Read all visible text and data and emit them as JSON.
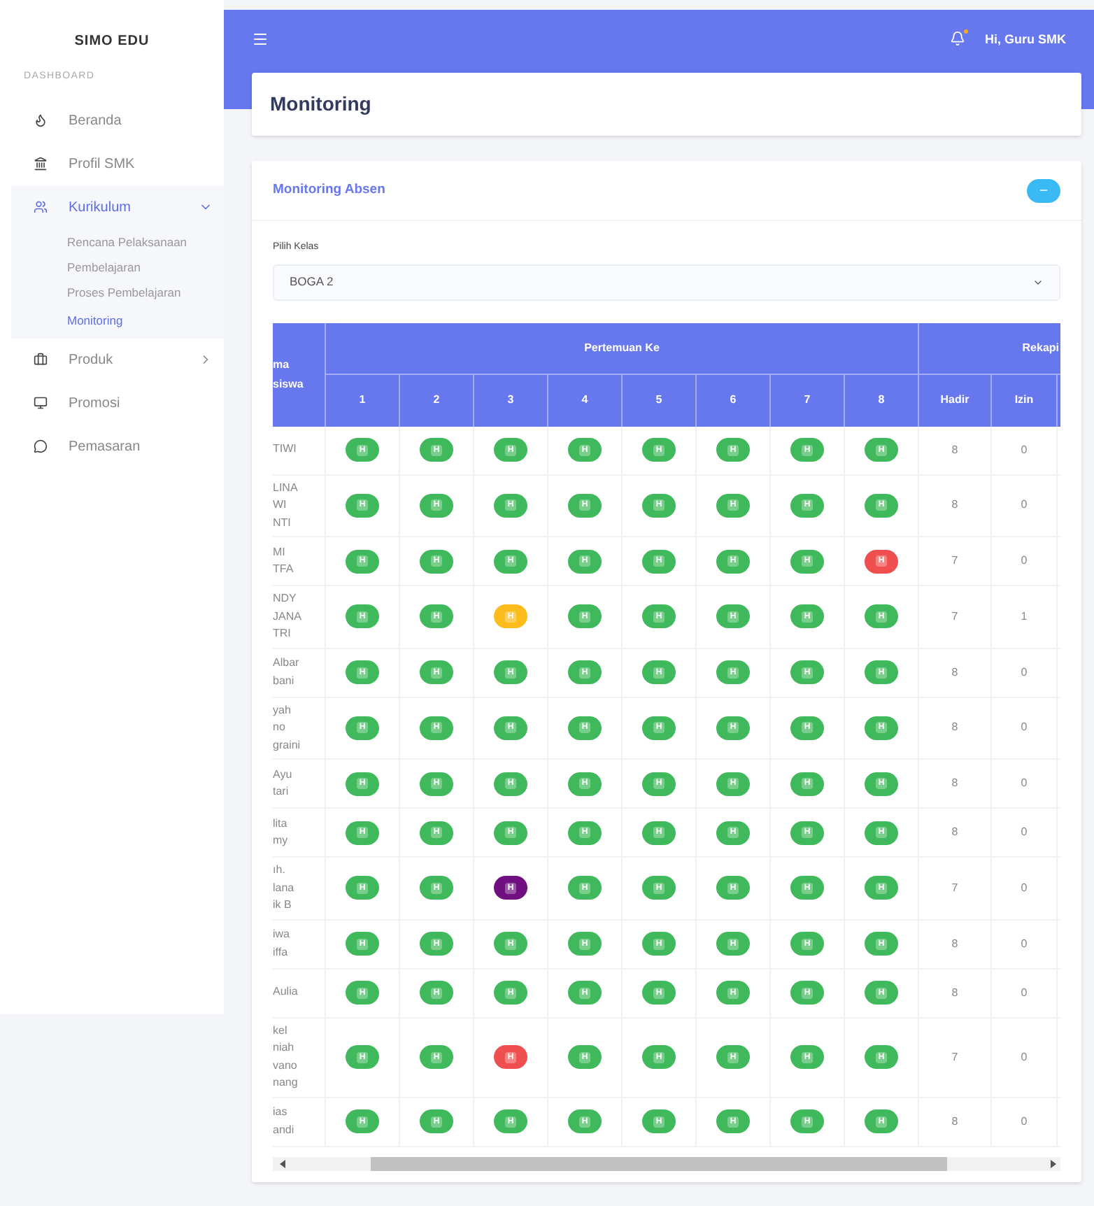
{
  "sidebar": {
    "brand": "SIMO EDU",
    "section": "DASHBOARD",
    "items": [
      {
        "label": "Beranda",
        "kind": "link",
        "selected": false
      },
      {
        "label": "Profil SMK",
        "kind": "link",
        "selected": false
      },
      {
        "label": "Kurikulum",
        "kind": "menu",
        "selected": true,
        "expanded": true,
        "children": [
          {
            "label": "Rencana Pelaksanaan",
            "selected": false
          },
          {
            "label": "Pembelajaran",
            "selected": false
          },
          {
            "label": "Proses Pembelajaran",
            "selected": false
          },
          {
            "label": "Monitoring",
            "selected": true
          }
        ]
      },
      {
        "label": "Produk",
        "kind": "menu",
        "selected": false,
        "expanded": false
      },
      {
        "label": "Promosi",
        "kind": "link",
        "selected": false
      },
      {
        "label": "Pemasaran",
        "kind": "link",
        "selected": false
      }
    ]
  },
  "topbar": {
    "user": "Hi, Guru SMK"
  },
  "page_title": "Monitoring",
  "panel": {
    "title": "Monitoring Absen",
    "field_label": "Pilih Kelas",
    "field_value": "BOGA 2",
    "table": {
      "name_header": [
        "ma",
        "siswa"
      ],
      "group_header": "Pertemuan Ke",
      "meetings": [
        "1",
        "2",
        "3",
        "4",
        "5",
        "6",
        "7",
        "8"
      ],
      "recap_header": "Rekapi",
      "recap_columns": [
        "Hadir",
        "Izin"
      ],
      "rows": [
        {
          "name": [
            "TIWI"
          ],
          "marks": [
            {
              "label": "H",
              "color": "#3fb95b"
            },
            {
              "label": "H",
              "color": "#3fb95b"
            },
            {
              "label": "H",
              "color": "#3fb95b"
            },
            {
              "label": "H",
              "color": "#3fb95b"
            },
            {
              "label": "H",
              "color": "#3fb95b"
            },
            {
              "label": "H",
              "color": "#3fb95b"
            },
            {
              "label": "H",
              "color": "#3fb95b"
            },
            {
              "label": "H",
              "color": "#3fb95b"
            }
          ],
          "hadir": "8",
          "izin": "0"
        },
        {
          "name": [
            "LINA",
            "WI",
            "NTI"
          ],
          "marks": [
            {
              "label": "H",
              "color": "#3fb95b"
            },
            {
              "label": "H",
              "color": "#3fb95b"
            },
            {
              "label": "H",
              "color": "#3fb95b"
            },
            {
              "label": "H",
              "color": "#3fb95b"
            },
            {
              "label": "H",
              "color": "#3fb95b"
            },
            {
              "label": "H",
              "color": "#3fb95b"
            },
            {
              "label": "H",
              "color": "#3fb95b"
            },
            {
              "label": "H",
              "color": "#3fb95b"
            }
          ],
          "hadir": "8",
          "izin": "0"
        },
        {
          "name": [
            "MI",
            "TFA"
          ],
          "marks": [
            {
              "label": "H",
              "color": "#3fb95b"
            },
            {
              "label": "H",
              "color": "#3fb95b"
            },
            {
              "label": "H",
              "color": "#3fb95b"
            },
            {
              "label": "H",
              "color": "#3fb95b"
            },
            {
              "label": "H",
              "color": "#3fb95b"
            },
            {
              "label": "H",
              "color": "#3fb95b"
            },
            {
              "label": "H",
              "color": "#3fb95b"
            },
            {
              "label": "H",
              "color": "#ef4f4f"
            }
          ],
          "hadir": "7",
          "izin": "0"
        },
        {
          "name": [
            "NDY",
            "JANA",
            "TRI"
          ],
          "marks": [
            {
              "label": "H",
              "color": "#3fb95b"
            },
            {
              "label": "H",
              "color": "#3fb95b"
            },
            {
              "label": "H",
              "color": "#fbbc1c"
            },
            {
              "label": "H",
              "color": "#3fb95b"
            },
            {
              "label": "H",
              "color": "#3fb95b"
            },
            {
              "label": "H",
              "color": "#3fb95b"
            },
            {
              "label": "H",
              "color": "#3fb95b"
            },
            {
              "label": "H",
              "color": "#3fb95b"
            }
          ],
          "hadir": "7",
          "izin": "1"
        },
        {
          "name": [
            "Albar",
            "bani"
          ],
          "marks": [
            {
              "label": "H",
              "color": "#3fb95b"
            },
            {
              "label": "H",
              "color": "#3fb95b"
            },
            {
              "label": "H",
              "color": "#3fb95b"
            },
            {
              "label": "H",
              "color": "#3fb95b"
            },
            {
              "label": "H",
              "color": "#3fb95b"
            },
            {
              "label": "H",
              "color": "#3fb95b"
            },
            {
              "label": "H",
              "color": "#3fb95b"
            },
            {
              "label": "H",
              "color": "#3fb95b"
            }
          ],
          "hadir": "8",
          "izin": "0"
        },
        {
          "name": [
            "yah",
            "no",
            "graini"
          ],
          "marks": [
            {
              "label": "H",
              "color": "#3fb95b"
            },
            {
              "label": "H",
              "color": "#3fb95b"
            },
            {
              "label": "H",
              "color": "#3fb95b"
            },
            {
              "label": "H",
              "color": "#3fb95b"
            },
            {
              "label": "H",
              "color": "#3fb95b"
            },
            {
              "label": "H",
              "color": "#3fb95b"
            },
            {
              "label": "H",
              "color": "#3fb95b"
            },
            {
              "label": "H",
              "color": "#3fb95b"
            }
          ],
          "hadir": "8",
          "izin": "0"
        },
        {
          "name": [
            "Ayu",
            "tari"
          ],
          "marks": [
            {
              "label": "H",
              "color": "#3fb95b"
            },
            {
              "label": "H",
              "color": "#3fb95b"
            },
            {
              "label": "H",
              "color": "#3fb95b"
            },
            {
              "label": "H",
              "color": "#3fb95b"
            },
            {
              "label": "H",
              "color": "#3fb95b"
            },
            {
              "label": "H",
              "color": "#3fb95b"
            },
            {
              "label": "H",
              "color": "#3fb95b"
            },
            {
              "label": "H",
              "color": "#3fb95b"
            }
          ],
          "hadir": "8",
          "izin": "0"
        },
        {
          "name": [
            "lita",
            "my"
          ],
          "marks": [
            {
              "label": "H",
              "color": "#3fb95b"
            },
            {
              "label": "H",
              "color": "#3fb95b"
            },
            {
              "label": "H",
              "color": "#3fb95b"
            },
            {
              "label": "H",
              "color": "#3fb95b"
            },
            {
              "label": "H",
              "color": "#3fb95b"
            },
            {
              "label": "H",
              "color": "#3fb95b"
            },
            {
              "label": "H",
              "color": "#3fb95b"
            },
            {
              "label": "H",
              "color": "#3fb95b"
            }
          ],
          "hadir": "8",
          "izin": "0"
        },
        {
          "name": [
            "ıh.",
            "lana",
            "ik B"
          ],
          "marks": [
            {
              "label": "H",
              "color": "#3fb95b"
            },
            {
              "label": "H",
              "color": "#3fb95b"
            },
            {
              "label": "H",
              "color": "#6f0f80"
            },
            {
              "label": "H",
              "color": "#3fb95b"
            },
            {
              "label": "H",
              "color": "#3fb95b"
            },
            {
              "label": "H",
              "color": "#3fb95b"
            },
            {
              "label": "H",
              "color": "#3fb95b"
            },
            {
              "label": "H",
              "color": "#3fb95b"
            }
          ],
          "hadir": "7",
          "izin": "0"
        },
        {
          "name": [
            "iwa",
            "iffa"
          ],
          "marks": [
            {
              "label": "H",
              "color": "#3fb95b"
            },
            {
              "label": "H",
              "color": "#3fb95b"
            },
            {
              "label": "H",
              "color": "#3fb95b"
            },
            {
              "label": "H",
              "color": "#3fb95b"
            },
            {
              "label": "H",
              "color": "#3fb95b"
            },
            {
              "label": "H",
              "color": "#3fb95b"
            },
            {
              "label": "H",
              "color": "#3fb95b"
            },
            {
              "label": "H",
              "color": "#3fb95b"
            }
          ],
          "hadir": "8",
          "izin": "0"
        },
        {
          "name": [
            "Aulia"
          ],
          "marks": [
            {
              "label": "H",
              "color": "#3fb95b"
            },
            {
              "label": "H",
              "color": "#3fb95b"
            },
            {
              "label": "H",
              "color": "#3fb95b"
            },
            {
              "label": "H",
              "color": "#3fb95b"
            },
            {
              "label": "H",
              "color": "#3fb95b"
            },
            {
              "label": "H",
              "color": "#3fb95b"
            },
            {
              "label": "H",
              "color": "#3fb95b"
            },
            {
              "label": "H",
              "color": "#3fb95b"
            }
          ],
          "hadir": "8",
          "izin": "0"
        },
        {
          "name": [
            "kel",
            "niah",
            "vano",
            "nang"
          ],
          "marks": [
            {
              "label": "H",
              "color": "#3fb95b"
            },
            {
              "label": "H",
              "color": "#3fb95b"
            },
            {
              "label": "H",
              "color": "#ef4f4f"
            },
            {
              "label": "H",
              "color": "#3fb95b"
            },
            {
              "label": "H",
              "color": "#3fb95b"
            },
            {
              "label": "H",
              "color": "#3fb95b"
            },
            {
              "label": "H",
              "color": "#3fb95b"
            },
            {
              "label": "H",
              "color": "#3fb95b"
            }
          ],
          "hadir": "7",
          "izin": "0"
        },
        {
          "name": [
            "ias",
            "andi"
          ],
          "marks": [
            {
              "label": "H",
              "color": "#3fb95b"
            },
            {
              "label": "H",
              "color": "#3fb95b"
            },
            {
              "label": "H",
              "color": "#3fb95b"
            },
            {
              "label": "H",
              "color": "#3fb95b"
            },
            {
              "label": "H",
              "color": "#3fb95b"
            },
            {
              "label": "H",
              "color": "#3fb95b"
            },
            {
              "label": "H",
              "color": "#3fb95b"
            },
            {
              "label": "H",
              "color": "#3fb95b"
            }
          ],
          "hadir": "8",
          "izin": "0"
        }
      ]
    }
  }
}
